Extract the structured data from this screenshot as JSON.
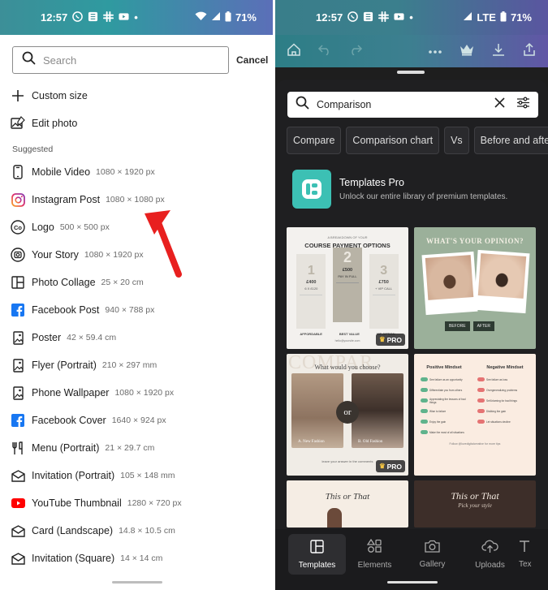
{
  "left": {
    "status": {
      "time": "12:57",
      "battery": "71%"
    },
    "search": {
      "placeholder": "Search"
    },
    "cancel_label": "Cancel",
    "actions": [
      {
        "label": "Custom size",
        "icon": "plus-icon"
      },
      {
        "label": "Edit photo",
        "icon": "edit-photo-icon"
      }
    ],
    "suggested_label": "Suggested",
    "items": [
      {
        "label": "Mobile Video",
        "dim": "1080 × 1920 px",
        "icon": "phone-icon"
      },
      {
        "label": "Instagram Post",
        "dim": "1080 × 1080 px",
        "icon": "instagram-icon"
      },
      {
        "label": "Logo",
        "dim": "500 × 500 px",
        "icon": "logo-icon"
      },
      {
        "label": "Your Story",
        "dim": "1080 × 1920 px",
        "icon": "story-icon"
      },
      {
        "label": "Photo Collage",
        "dim": "25 × 20 cm",
        "icon": "collage-icon"
      },
      {
        "label": "Facebook Post",
        "dim": "940 × 788 px",
        "icon": "facebook-icon"
      },
      {
        "label": "Poster",
        "dim": "42 × 59.4 cm",
        "icon": "poster-icon"
      },
      {
        "label": "Flyer (Portrait)",
        "dim": "210 × 297 mm",
        "icon": "flyer-icon"
      },
      {
        "label": "Phone Wallpaper",
        "dim": "1080 × 1920 px",
        "icon": "wallpaper-icon"
      },
      {
        "label": "Facebook Cover",
        "dim": "1640 × 924 px",
        "icon": "facebook-icon"
      },
      {
        "label": "Menu (Portrait)",
        "dim": "21 × 29.7 cm",
        "icon": "menu-utensils-icon"
      },
      {
        "label": "Invitation (Portrait)",
        "dim": "105 × 148 mm",
        "icon": "envelope-icon"
      },
      {
        "label": "YouTube Thumbnail",
        "dim": "1280 × 720 px",
        "icon": "youtube-icon"
      },
      {
        "label": "Card (Landscape)",
        "dim": "14.8 × 10.5 cm",
        "icon": "envelope-icon"
      },
      {
        "label": "Invitation (Square)",
        "dim": "14 × 14 cm",
        "icon": "envelope-icon"
      }
    ],
    "colors": {
      "arrow": "#e8201f",
      "instagram": "#d6249f",
      "facebook": "#1877f2",
      "youtube": "#ff0000"
    }
  },
  "right": {
    "status": {
      "time": "12:57",
      "network": "LTE",
      "battery": "71%"
    },
    "search": {
      "value": "Comparison"
    },
    "chips": [
      "Compare",
      "Comparison chart",
      "Vs",
      "Before and after"
    ],
    "pro": {
      "title": "Templates Pro",
      "subtitle": "Unlock our entire library of premium templates."
    },
    "templates": {
      "t1": {
        "kicker": "A BREAKDOWN OF YOUR",
        "title": "COURSE PAYMENT OPTIONS",
        "cols": [
          {
            "num": "1",
            "price": "£400",
            "sub": "6 X £120"
          },
          {
            "num": "2",
            "price": "£500",
            "sub": "PAY IN FULL"
          },
          {
            "num": "3",
            "price": "£750",
            "sub": "+ VIP CALL"
          }
        ],
        "footer": [
          "AFFORDABLE",
          "BEST VALUE",
          "VIP OPTION"
        ],
        "email": "hello@yoursite.com",
        "pro": "PRO"
      },
      "t2": {
        "title": "WHAT'S YOUR OPINION?",
        "left": "BEFORE",
        "right": "AFTER"
      },
      "t3": {
        "bg": "COMPAR",
        "question": "What would you choose?",
        "vs": "or",
        "a": "A. New Fashion",
        "b": "B. Old Fashion",
        "foot": "leave your answer in the comments",
        "pro": "PRO"
      },
      "t4": {
        "left": "Positive Mindset",
        "right": "Negative Mindset",
        "pos": [
          "See failure as an opportunity",
          "Differentiate you from others",
          "Appreciating the lessons of bad things",
          "Wise to failure",
          "Enjoy the gain",
          "Make the most of all situations"
        ],
        "neg": [
          "See failure as loss",
          "Overgeneralizing problems",
          "Self-blaming for bad things",
          "Disliking the gain",
          "Let situations decline"
        ],
        "foot": "Follow @lovedigitalcreative for more tips"
      },
      "t5": {
        "title": "This or That"
      },
      "t6": {
        "title": "This or That",
        "sub": "Pick your style"
      }
    },
    "nav": [
      {
        "label": "Templates",
        "icon": "templates-icon",
        "active": true
      },
      {
        "label": "Elements",
        "icon": "elements-icon",
        "active": false
      },
      {
        "label": "Gallery",
        "icon": "camera-icon",
        "active": false
      },
      {
        "label": "Uploads",
        "icon": "upload-cloud-icon",
        "active": false
      },
      {
        "label": "Tex",
        "icon": "text-icon",
        "active": false
      }
    ]
  }
}
